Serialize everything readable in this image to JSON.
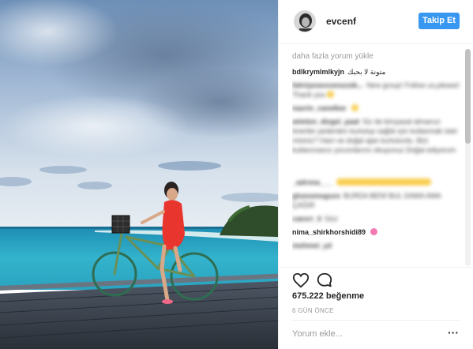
{
  "post": {
    "username": "evcenf",
    "follow_label": "Takip Et",
    "image_subject": "photo"
  },
  "comments": {
    "load_more_label": "daha fazla yorum yükle",
    "items": [
      {
        "user": "bdlkrymlmlkyjn",
        "text": "متونة لا بحبك",
        "blurred": false
      },
      {
        "user": "fahriyesevcenozsik...",
        "text": "New group! Follow us,please! Thank you",
        "blurred": true,
        "emoji": "yellow"
      },
      {
        "user": "nasrin_canelkar",
        "text": "",
        "blurred": true,
        "emoji": "yellow"
      },
      {
        "user": "wimlon_dizgel_paat",
        "text": "Siz de kimyasal almanızı öneriler pederden kurtulup sağlık için kullanmak ister misiniz? Ham ve doğal ajan kurtulurdu. Bizi kullanırsanız yorumlarımı okuyunuz Doğal ediyorum",
        "blurred": true
      },
      {
        "user": "_adrnna___",
        "text": "",
        "blurred": true,
        "emoji": "yellow"
      },
      {
        "user": "gluesonoguzo",
        "text": "BURDA BENİ BUL DAMA AMA ÇAĞIR",
        "blurred": true
      },
      {
        "user": "caesrr_li",
        "text": "Sizz",
        "blurred": true
      },
      {
        "user": "nima_shirkhorshidi89",
        "text": "",
        "blurred": false,
        "emoji": "pink"
      },
      {
        "user": "mehmet_yd",
        "text": "",
        "blurred": true
      }
    ]
  },
  "actions": {
    "like_icon": "heart-outline-icon",
    "comment_icon": "comment-bubble-icon",
    "likes_text": "675.222 beğenme",
    "timestamp": "6 GÜN ÖNCE",
    "comment_placeholder": "Yorum ekle...",
    "more_label": "···"
  },
  "colors": {
    "follow_button": "#3897f0",
    "border": "#efefef",
    "secondary_text": "#999999",
    "primary_text": "#262626"
  }
}
